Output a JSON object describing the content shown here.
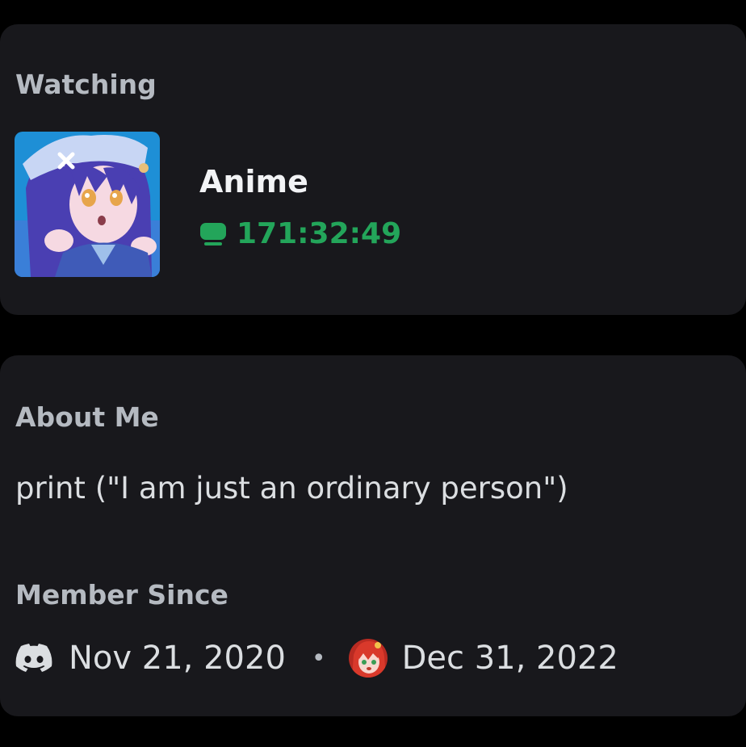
{
  "activity": {
    "section_title": "Watching",
    "name": "Anime",
    "elapsed": "171:32:49",
    "elapsed_icon": "screen-icon",
    "image": "anime-girl-avatar"
  },
  "about": {
    "section_title": "About Me",
    "bio": "print (\"I am just an ordinary person\")"
  },
  "member_since": {
    "section_title": "Member Since",
    "discord_icon": "discord-icon",
    "discord_date": "Nov 21, 2020",
    "separator": "•",
    "server_icon": "server-avatar-icon",
    "server_date": "Dec 31, 2022"
  },
  "colors": {
    "background": "#000000",
    "card": "#18181c",
    "heading": "#b5bac1",
    "text": "#dbdee1",
    "accent_green": "#23a55a"
  }
}
